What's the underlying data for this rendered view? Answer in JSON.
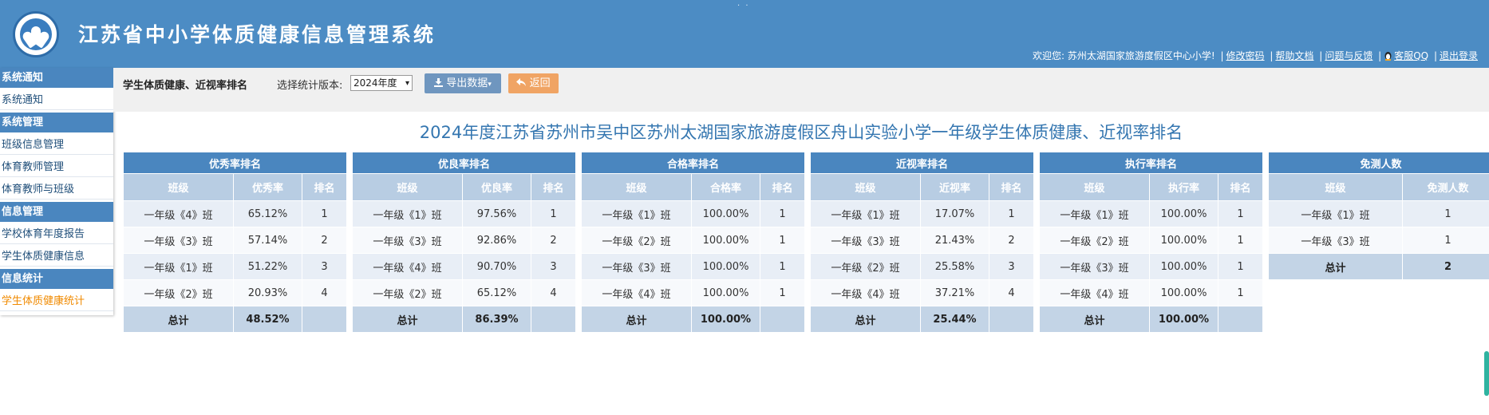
{
  "header": {
    "title": "江苏省中小学体质健康信息管理系统",
    "dots": "· ·",
    "welcome": "欢迎您: 苏州太湖国家旅游度假区中心小学!",
    "links": [
      "修改密码",
      "帮助文档",
      "问题与反馈",
      "客服QQ",
      "退出登录"
    ]
  },
  "sidebar": {
    "sections": [
      {
        "title": "系统通知",
        "items": [
          "系统通知"
        ]
      },
      {
        "title": "系统管理",
        "items": [
          "班级信息管理",
          "体育教师管理",
          "体育教师与班级"
        ]
      },
      {
        "title": "信息管理",
        "items": [
          "学校体育年度报告",
          "学生体质健康信息"
        ]
      },
      {
        "title": "信息统计",
        "items": [
          "学生体质健康统计"
        ]
      }
    ]
  },
  "toolbar": {
    "page_title": "学生体质健康、近视率排名",
    "version_label": "选择统计版本:",
    "version_value": "2024年度",
    "export_label": "导出数据",
    "back_label": "返回"
  },
  "report_title": "2024年度江苏省苏州市吴中区苏州太湖国家旅游度假区舟山实验小学一年级学生体质健康、近视率排名",
  "tables": [
    {
      "caption": "优秀率排名",
      "headers": [
        "班级",
        "优秀率",
        "排名"
      ],
      "rows": [
        [
          "一年级《4》班",
          "65.12%",
          "1"
        ],
        [
          "一年级《3》班",
          "57.14%",
          "2"
        ],
        [
          "一年级《1》班",
          "51.22%",
          "3"
        ],
        [
          "一年级《2》班",
          "20.93%",
          "4"
        ]
      ],
      "total": [
        "总计",
        "48.52%",
        ""
      ]
    },
    {
      "caption": "优良率排名",
      "headers": [
        "班级",
        "优良率",
        "排名"
      ],
      "rows": [
        [
          "一年级《1》班",
          "97.56%",
          "1"
        ],
        [
          "一年级《3》班",
          "92.86%",
          "2"
        ],
        [
          "一年级《4》班",
          "90.70%",
          "3"
        ],
        [
          "一年级《2》班",
          "65.12%",
          "4"
        ]
      ],
      "total": [
        "总计",
        "86.39%",
        ""
      ]
    },
    {
      "caption": "合格率排名",
      "headers": [
        "班级",
        "合格率",
        "排名"
      ],
      "rows": [
        [
          "一年级《1》班",
          "100.00%",
          "1"
        ],
        [
          "一年级《2》班",
          "100.00%",
          "1"
        ],
        [
          "一年级《3》班",
          "100.00%",
          "1"
        ],
        [
          "一年级《4》班",
          "100.00%",
          "1"
        ]
      ],
      "total": [
        "总计",
        "100.00%",
        ""
      ]
    },
    {
      "caption": "近视率排名",
      "headers": [
        "班级",
        "近视率",
        "排名"
      ],
      "rows": [
        [
          "一年级《1》班",
          "17.07%",
          "1"
        ],
        [
          "一年级《3》班",
          "21.43%",
          "2"
        ],
        [
          "一年级《2》班",
          "25.58%",
          "3"
        ],
        [
          "一年级《4》班",
          "37.21%",
          "4"
        ]
      ],
      "total": [
        "总计",
        "25.44%",
        ""
      ]
    },
    {
      "caption": "执行率排名",
      "headers": [
        "班级",
        "执行率",
        "排名"
      ],
      "rows": [
        [
          "一年级《1》班",
          "100.00%",
          "1"
        ],
        [
          "一年级《2》班",
          "100.00%",
          "1"
        ],
        [
          "一年级《3》班",
          "100.00%",
          "1"
        ],
        [
          "一年级《4》班",
          "100.00%",
          "1"
        ]
      ],
      "total": [
        "总计",
        "100.00%",
        ""
      ]
    },
    {
      "caption": "免测人数",
      "headers": [
        "班级",
        "免测人数"
      ],
      "rows": [
        [
          "一年级《1》班",
          "1"
        ],
        [
          "一年级《3》班",
          "1"
        ]
      ],
      "total": [
        "总计",
        "2"
      ]
    }
  ]
}
